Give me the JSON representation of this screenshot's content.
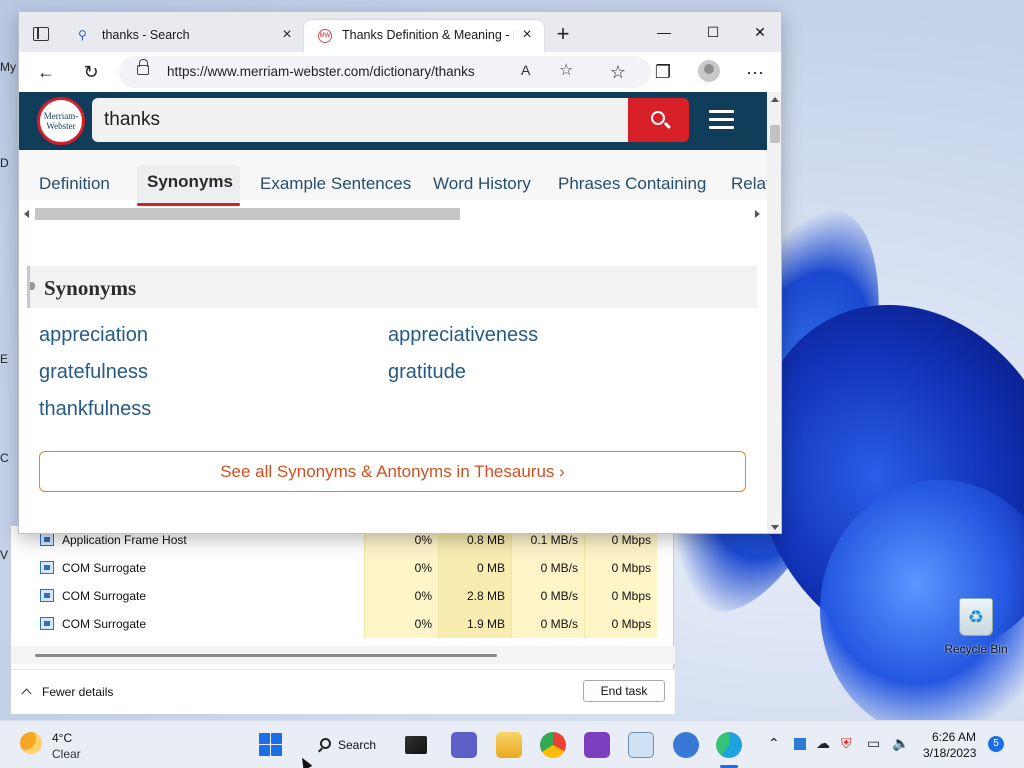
{
  "desktop": {
    "left_fragments": [
      "My",
      "D",
      "E",
      "C",
      "V"
    ],
    "recycle_bin_label": "Recycle Bin"
  },
  "browser": {
    "tabs": [
      {
        "label": "thanks - Search",
        "icon": "search-icon"
      },
      {
        "label": "Thanks Definition & Meaning - Merriam-Webster",
        "icon": "merriam-webster-favicon"
      }
    ],
    "window_controls": {
      "minimize": "—",
      "maximize": "☐",
      "close": "✕"
    },
    "url": "https://www.merriam-webster.com/dictionary/thanks",
    "read_aloud_label": "A",
    "more_label": "···"
  },
  "page": {
    "logo_text_top": "Merriam-",
    "logo_text_bottom": "Webster",
    "search_value": "thanks",
    "subnav": [
      "Definition",
      "Synonyms",
      "Example Sentences",
      "Word History",
      "Phrases Containing",
      "Relat"
    ],
    "active_subnav": "Synonyms",
    "section_title": "Synonyms",
    "synonyms": [
      "appreciation",
      "appreciativeness",
      "gratefulness",
      "gratitude",
      "thankfulness"
    ],
    "thesaurus_button": "See all Synonyms & Antonyms in Thesaurus ›"
  },
  "task_manager": {
    "rows": [
      {
        "name": "Application Frame Host",
        "cpu": "0%",
        "memory": "0.8 MB",
        "disk": "0.1 MB/s",
        "network": "0 Mbps"
      },
      {
        "name": "COM Surrogate",
        "cpu": "0%",
        "memory": "0 MB",
        "disk": "0 MB/s",
        "network": "0 Mbps"
      },
      {
        "name": "COM Surrogate",
        "cpu": "0%",
        "memory": "2.8 MB",
        "disk": "0 MB/s",
        "network": "0 Mbps"
      },
      {
        "name": "COM Surrogate",
        "cpu": "0%",
        "memory": "1.9 MB",
        "disk": "0 MB/s",
        "network": "0 Mbps"
      }
    ],
    "fewer_details": "Fewer details",
    "end_task": "End task"
  },
  "taskbar": {
    "weather_temp": "4°C",
    "weather_condition": "Clear",
    "search_label": "Search",
    "time": "6:26 AM",
    "date": "3/18/2023",
    "notification_count": "5"
  },
  "colors": {
    "mw_header": "#0f3d5a",
    "mw_red": "#d71f28",
    "link_blue": "#265a86",
    "accent_orange": "#d24f1f"
  }
}
